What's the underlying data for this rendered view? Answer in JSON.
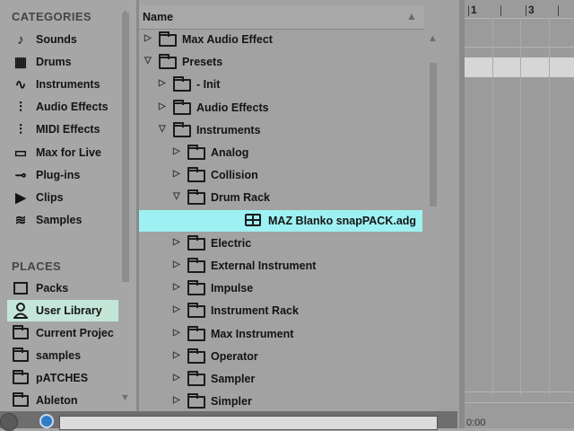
{
  "left_panel": {
    "categories_heading": "CATEGORIES",
    "categories": [
      {
        "label": "Sounds",
        "icon": "♪"
      },
      {
        "label": "Drums",
        "icon": "▦"
      },
      {
        "label": "Instruments",
        "icon": "∿"
      },
      {
        "label": "Audio Effects",
        "icon": "⫶"
      },
      {
        "label": "MIDI Effects",
        "icon": "⫶"
      },
      {
        "label": "Max for Live",
        "icon": "▭"
      },
      {
        "label": "Plug-ins",
        "icon": "⊸"
      },
      {
        "label": "Clips",
        "icon": "▶"
      },
      {
        "label": "Samples",
        "icon": "≋"
      }
    ],
    "places_heading": "PLACES",
    "places": [
      {
        "label": "Packs"
      },
      {
        "label": "User Library"
      },
      {
        "label": "Current Projec"
      },
      {
        "label": "samples"
      },
      {
        "label": "pATCHES"
      },
      {
        "label": "Ableton"
      }
    ]
  },
  "browser": {
    "column_header": "Name",
    "rows": [
      {
        "label": "Max Audio Effect",
        "expanded": false
      },
      {
        "label": "Presets",
        "expanded": true
      },
      {
        "label": "- Init",
        "expanded": false
      },
      {
        "label": "Audio Effects",
        "expanded": false
      },
      {
        "label": "Instruments",
        "expanded": true
      },
      {
        "label": "Analog",
        "expanded": false
      },
      {
        "label": "Collision",
        "expanded": false
      },
      {
        "label": "Drum Rack",
        "expanded": true
      },
      {
        "label": "MAZ Blanko snapPACK.adg",
        "selected": true
      },
      {
        "label": "Electric",
        "expanded": false
      },
      {
        "label": "External Instrument",
        "expanded": false
      },
      {
        "label": "Impulse",
        "expanded": false
      },
      {
        "label": "Instrument Rack",
        "expanded": false
      },
      {
        "label": "Max Instrument",
        "expanded": false
      },
      {
        "label": "Operator",
        "expanded": false
      },
      {
        "label": "Sampler",
        "expanded": false
      },
      {
        "label": "Simpler",
        "expanded": false
      }
    ]
  },
  "arrangement": {
    "bar_numbers": [
      "1",
      "3"
    ],
    "time_label": "0:00"
  },
  "colors": {
    "selection": "#9ef1f2",
    "place_selection": "#c4e6d9",
    "info_icon": "#2e7bc6"
  }
}
